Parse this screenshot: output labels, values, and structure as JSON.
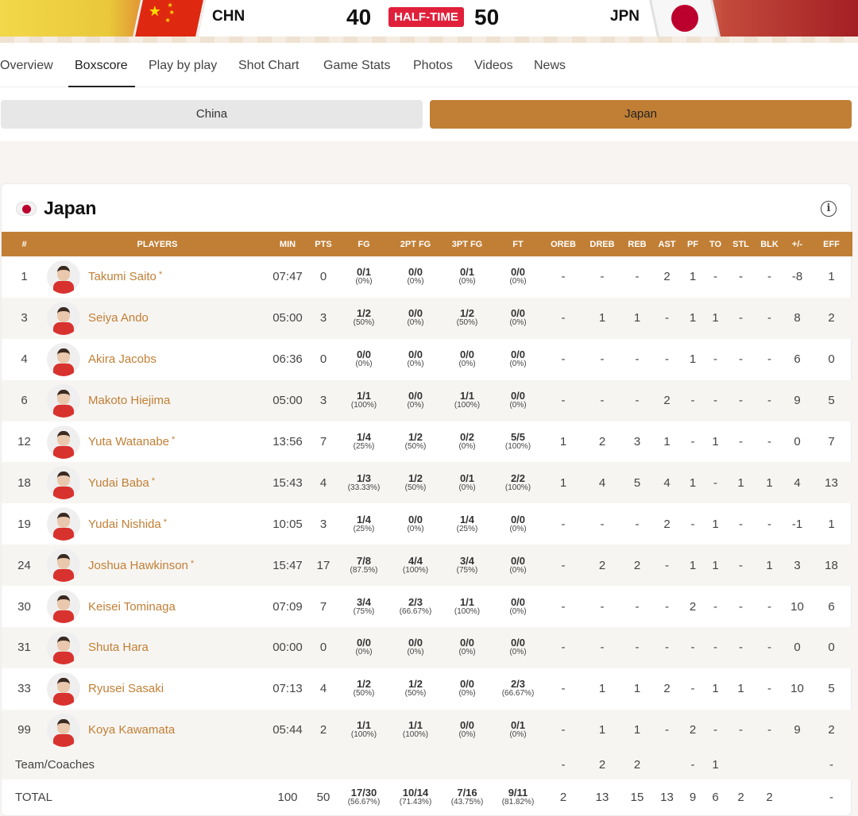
{
  "header": {
    "home_code": "CHN",
    "away_code": "JPN",
    "home_score": "40",
    "away_score": "50",
    "status": "HALF-TIME",
    "home_flag_icon": "china-flag-icon",
    "away_flag_icon": "japan-flag-icon",
    "status_color": "#e0203a"
  },
  "tabs": [
    "Overview",
    "Boxscore",
    "Play by play",
    "Shot Chart",
    "Game Stats",
    "Photos",
    "Videos",
    "News"
  ],
  "active_tab": "Boxscore",
  "team_toggle": {
    "china": "China",
    "japan": "Japan",
    "selected": "Japan"
  },
  "card": {
    "title": "Japan",
    "info_icon": "info-icon",
    "accent": "#c17f35"
  },
  "columns": [
    "#",
    "PLAYERS",
    "MIN",
    "PTS",
    "FG",
    "2PT FG",
    "3PT FG",
    "FT",
    "OREB",
    "DREB",
    "REB",
    "AST",
    "PF",
    "TO",
    "STL",
    "BLK",
    "+/-",
    "EFF"
  ],
  "players": [
    {
      "num": "1",
      "name": "Takumi Saito",
      "starter": true,
      "on_court": false,
      "min": "07:47",
      "pts": "0",
      "fg": [
        "0/1",
        "(0%)"
      ],
      "fg2": [
        "0/0",
        "(0%)"
      ],
      "fg3": [
        "0/1",
        "(0%)"
      ],
      "ft": [
        "0/0",
        "(0%)"
      ],
      "oreb": "-",
      "dreb": "-",
      "reb": "-",
      "ast": "2",
      "pf": "1",
      "to": "-",
      "stl": "-",
      "blk": "-",
      "pm": "-8",
      "eff": "1"
    },
    {
      "num": "3",
      "name": "Seiya Ando",
      "starter": false,
      "on_court": false,
      "min": "05:00",
      "pts": "3",
      "fg": [
        "1/2",
        "(50%)"
      ],
      "fg2": [
        "0/0",
        "(0%)"
      ],
      "fg3": [
        "1/2",
        "(50%)"
      ],
      "ft": [
        "0/0",
        "(0%)"
      ],
      "oreb": "-",
      "dreb": "1",
      "reb": "1",
      "ast": "-",
      "pf": "1",
      "to": "1",
      "stl": "-",
      "blk": "-",
      "pm": "8",
      "eff": "2"
    },
    {
      "num": "4",
      "name": "Akira Jacobs",
      "starter": false,
      "on_court": false,
      "min": "06:36",
      "pts": "0",
      "fg": [
        "0/0",
        "(0%)"
      ],
      "fg2": [
        "0/0",
        "(0%)"
      ],
      "fg3": [
        "0/0",
        "(0%)"
      ],
      "ft": [
        "0/0",
        "(0%)"
      ],
      "oreb": "-",
      "dreb": "-",
      "reb": "-",
      "ast": "-",
      "pf": "1",
      "to": "-",
      "stl": "-",
      "blk": "-",
      "pm": "6",
      "eff": "0"
    },
    {
      "num": "6",
      "name": "Makoto Hiejima",
      "starter": false,
      "on_court": false,
      "min": "05:00",
      "pts": "3",
      "fg": [
        "1/1",
        "(100%)"
      ],
      "fg2": [
        "0/0",
        "(0%)"
      ],
      "fg3": [
        "1/1",
        "(100%)"
      ],
      "ft": [
        "0/0",
        "(0%)"
      ],
      "oreb": "-",
      "dreb": "-",
      "reb": "-",
      "ast": "2",
      "pf": "-",
      "to": "-",
      "stl": "-",
      "blk": "-",
      "pm": "9",
      "eff": "5"
    },
    {
      "num": "12",
      "name": "Yuta Watanabe",
      "starter": true,
      "on_court": true,
      "min": "13:56",
      "pts": "7",
      "fg": [
        "1/4",
        "(25%)"
      ],
      "fg2": [
        "1/2",
        "(50%)"
      ],
      "fg3": [
        "0/2",
        "(0%)"
      ],
      "ft": [
        "5/5",
        "(100%)"
      ],
      "oreb": "1",
      "dreb": "2",
      "reb": "3",
      "ast": "1",
      "pf": "-",
      "to": "1",
      "stl": "-",
      "blk": "-",
      "pm": "0",
      "eff": "7"
    },
    {
      "num": "18",
      "name": "Yudai Baba",
      "starter": true,
      "on_court": true,
      "min": "15:43",
      "pts": "4",
      "fg": [
        "1/3",
        "(33.33%)"
      ],
      "fg2": [
        "1/2",
        "(50%)"
      ],
      "fg3": [
        "0/1",
        "(0%)"
      ],
      "ft": [
        "2/2",
        "(100%)"
      ],
      "oreb": "1",
      "dreb": "4",
      "reb": "5",
      "ast": "4",
      "pf": "1",
      "to": "-",
      "stl": "1",
      "blk": "1",
      "pm": "4",
      "eff": "13"
    },
    {
      "num": "19",
      "name": "Yudai Nishida",
      "starter": true,
      "on_court": true,
      "min": "10:05",
      "pts": "3",
      "fg": [
        "1/4",
        "(25%)"
      ],
      "fg2": [
        "0/0",
        "(0%)"
      ],
      "fg3": [
        "1/4",
        "(25%)"
      ],
      "ft": [
        "0/0",
        "(0%)"
      ],
      "oreb": "-",
      "dreb": "-",
      "reb": "-",
      "ast": "2",
      "pf": "-",
      "to": "1",
      "stl": "-",
      "blk": "-",
      "pm": "-1",
      "eff": "1"
    },
    {
      "num": "24",
      "name": "Joshua Hawkinson",
      "starter": true,
      "on_court": true,
      "min": "15:47",
      "pts": "17",
      "fg": [
        "7/8",
        "(87.5%)"
      ],
      "fg2": [
        "4/4",
        "(100%)"
      ],
      "fg3": [
        "3/4",
        "(75%)"
      ],
      "ft": [
        "0/0",
        "(0%)"
      ],
      "oreb": "-",
      "dreb": "2",
      "reb": "2",
      "ast": "-",
      "pf": "1",
      "to": "1",
      "stl": "-",
      "blk": "1",
      "pm": "3",
      "eff": "18"
    },
    {
      "num": "30",
      "name": "Keisei Tominaga",
      "starter": false,
      "on_court": false,
      "min": "07:09",
      "pts": "7",
      "fg": [
        "3/4",
        "(75%)"
      ],
      "fg2": [
        "2/3",
        "(66.67%)"
      ],
      "fg3": [
        "1/1",
        "(100%)"
      ],
      "ft": [
        "0/0",
        "(0%)"
      ],
      "oreb": "-",
      "dreb": "-",
      "reb": "-",
      "ast": "-",
      "pf": "2",
      "to": "-",
      "stl": "-",
      "blk": "-",
      "pm": "10",
      "eff": "6"
    },
    {
      "num": "31",
      "name": "Shuta Hara",
      "starter": false,
      "on_court": false,
      "min": "00:00",
      "pts": "0",
      "fg": [
        "0/0",
        "(0%)"
      ],
      "fg2": [
        "0/0",
        "(0%)"
      ],
      "fg3": [
        "0/0",
        "(0%)"
      ],
      "ft": [
        "0/0",
        "(0%)"
      ],
      "oreb": "-",
      "dreb": "-",
      "reb": "-",
      "ast": "-",
      "pf": "-",
      "to": "-",
      "stl": "-",
      "blk": "-",
      "pm": "0",
      "eff": "0"
    },
    {
      "num": "33",
      "name": "Ryusei Sasaki",
      "starter": false,
      "on_court": true,
      "min": "07:13",
      "pts": "4",
      "fg": [
        "1/2",
        "(50%)"
      ],
      "fg2": [
        "1/2",
        "(50%)"
      ],
      "fg3": [
        "0/0",
        "(0%)"
      ],
      "ft": [
        "2/3",
        "(66.67%)"
      ],
      "oreb": "-",
      "dreb": "1",
      "reb": "1",
      "ast": "2",
      "pf": "-",
      "to": "1",
      "stl": "1",
      "blk": "-",
      "pm": "10",
      "eff": "5"
    },
    {
      "num": "99",
      "name": "Koya Kawamata",
      "starter": false,
      "on_court": false,
      "min": "05:44",
      "pts": "2",
      "fg": [
        "1/1",
        "(100%)"
      ],
      "fg2": [
        "1/1",
        "(100%)"
      ],
      "fg3": [
        "0/0",
        "(0%)"
      ],
      "ft": [
        "0/1",
        "(0%)"
      ],
      "oreb": "-",
      "dreb": "1",
      "reb": "1",
      "ast": "-",
      "pf": "2",
      "to": "-",
      "stl": "-",
      "blk": "-",
      "pm": "9",
      "eff": "2"
    }
  ],
  "team_row": {
    "label": "Team/Coaches",
    "oreb": "-",
    "dreb": "2",
    "reb": "2",
    "ast": "",
    "pf": "-",
    "to": "1",
    "stl": "",
    "blk": "",
    "pm": "",
    "eff": "-"
  },
  "total_row": {
    "label": "TOTAL",
    "min": "100",
    "pts": "50",
    "fg": [
      "17/30",
      "(56.67%)"
    ],
    "fg2": [
      "10/14",
      "(71.43%)"
    ],
    "fg3": [
      "7/16",
      "(43.75%)"
    ],
    "ft": [
      "9/11",
      "(81.82%)"
    ],
    "oreb": "2",
    "dreb": "13",
    "reb": "15",
    "ast": "13",
    "pf": "9",
    "to": "6",
    "stl": "2",
    "blk": "2",
    "pm": "",
    "eff": "-"
  }
}
